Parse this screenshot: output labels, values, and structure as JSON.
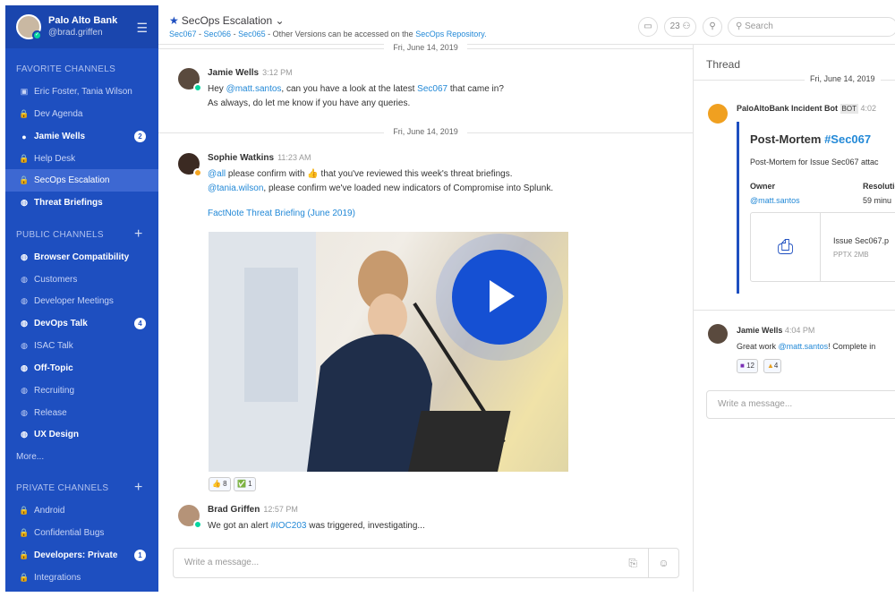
{
  "team": {
    "name": "Palo Alto Bank",
    "user": "@brad.griffen"
  },
  "sidebar": {
    "favorite_title": "FAVORITE CHANNELS",
    "favorites": [
      {
        "label": "Eric Foster, Tania Wilson",
        "icon": "2",
        "bold": false
      },
      {
        "label": "Dev Agenda",
        "icon": "lock",
        "bold": false
      },
      {
        "label": "Jamie Wells",
        "icon": "person",
        "bold": true,
        "badge": "2"
      },
      {
        "label": "Help Desk",
        "icon": "lock",
        "bold": false
      },
      {
        "label": "SecOps Escalation",
        "icon": "lock",
        "bold": false,
        "active": true
      },
      {
        "label": "Threat Briefings",
        "icon": "globe",
        "bold": true
      }
    ],
    "public_title": "PUBLIC CHANNELS",
    "public": [
      {
        "label": "Browser Compatibility",
        "bold": true
      },
      {
        "label": "Customers",
        "bold": false
      },
      {
        "label": "Developer Meetings",
        "bold": false
      },
      {
        "label": "DevOps Talk",
        "bold": true,
        "badge": "4"
      },
      {
        "label": "ISAC Talk",
        "bold": false
      },
      {
        "label": "Off-Topic",
        "bold": true
      },
      {
        "label": "Recruiting",
        "bold": false
      },
      {
        "label": "Release",
        "bold": false
      },
      {
        "label": "UX Design",
        "bold": true
      }
    ],
    "more": "More...",
    "private_title": "PRIVATE CHANNELS",
    "private": [
      {
        "label": "Android",
        "bold": false
      },
      {
        "label": "Confidential Bugs",
        "bold": false
      },
      {
        "label": "Developers: Private",
        "bold": true,
        "badge": "1"
      },
      {
        "label": "Integrations",
        "bold": false
      }
    ]
  },
  "header": {
    "channel": "SecOps Escalation",
    "sub_links": [
      "Sec067",
      "Sec066",
      "Sec065"
    ],
    "sub_text": " - Other Versions can be accessed on the ",
    "sub_repo": "SecOps Repository.",
    "members": "23",
    "search_placeholder": "Search"
  },
  "messages": {
    "date1": "Fri, June 14, 2019",
    "date2": "Fri, June 14, 2019",
    "m1": {
      "name": "Jamie Wells",
      "time": "3:12 PM",
      "l1a": "Hey ",
      "l1m": "@matt.santos",
      "l1b": ", can you have a look at the latest ",
      "l1c": "Sec067",
      "l1d": " that came in?",
      "l2": "As always, do let me know if you have any queries."
    },
    "m2": {
      "name": "Sophie Watkins",
      "time": "11:23 AM",
      "l1m": "@all",
      "l1b": " please confirm with ",
      "l1c": "👍",
      "l1d": " that you've reviewed this week's threat briefings.",
      "l2m": "@tania.wilson",
      "l2b": ", please confirm we've loaded new indicators of Compromise into Splunk.",
      "link": "FactNote Threat Briefing (June 2019)",
      "r1": "👍 8",
      "r2": "✅ 1"
    },
    "m3": {
      "name": "Brad Griffen",
      "time": "12:57 PM",
      "l1a": "We got an alert ",
      "l1m": "#IOC203",
      "l1b": " was triggered, investigating..."
    },
    "input_placeholder": "Write a message..."
  },
  "thread": {
    "title": "Thread",
    "date": "Fri, June 14, 2019",
    "bot_name": "PaloAltoBank Incident Bot",
    "bot_tag": "BOT",
    "bot_time": "4:02",
    "card_title_a": "Post-Mortem ",
    "card_title_b": "#Sec067",
    "card_sub": "Post-Mortem for Issue Sec067 attac",
    "owner_label": "Owner",
    "owner_value": "@matt.santos",
    "res_label": "Resolutio",
    "res_value": "59 minu",
    "file_name": "Issue Sec067.p",
    "file_meta": "PPTX 2MB",
    "reply_name": "Jamie Wells",
    "reply_time": "4:04 PM",
    "reply_a": "Great work ",
    "reply_m": "@matt.santos",
    "reply_b": "! Complete in",
    "r1": "12",
    "r2": "4",
    "input_placeholder": "Write a message..."
  }
}
